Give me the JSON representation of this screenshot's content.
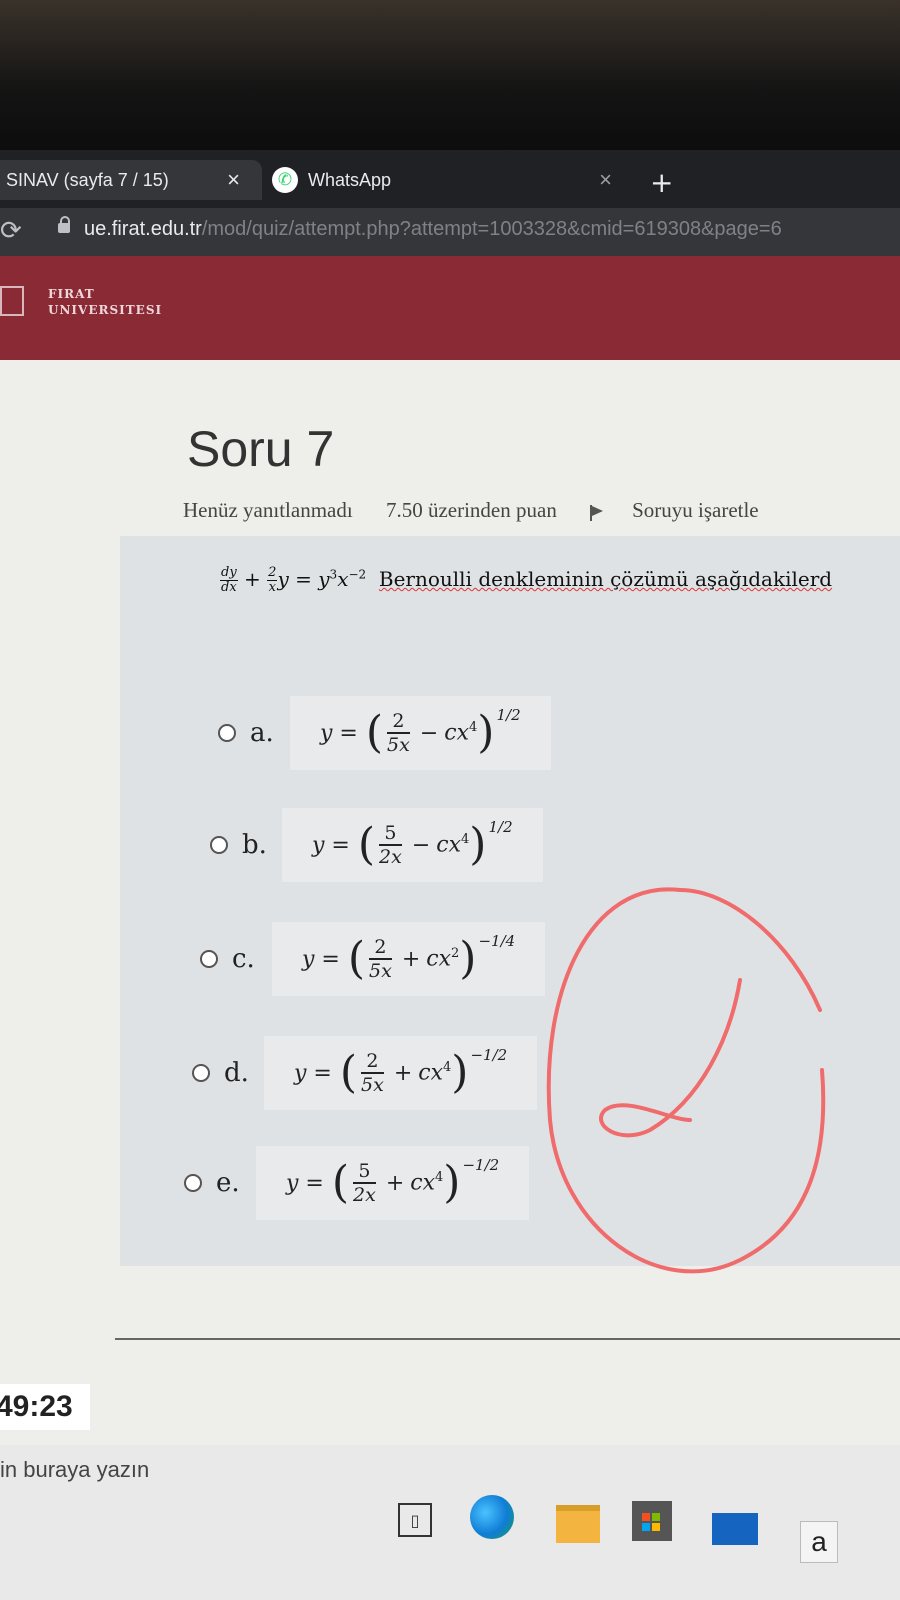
{
  "browser": {
    "tabs": [
      {
        "title": "SINAV (sayfa 7 / 15)",
        "close": "×"
      },
      {
        "title": "WhatsApp",
        "close": "×"
      }
    ],
    "new_tab": "+",
    "url_host": "ue.firat.edu.tr",
    "url_path": "/mod/quiz/attempt.php?attempt=1003328&cmid=619308&page=6"
  },
  "site": {
    "logo_line1": "FIRAT",
    "logo_line2": "UNIVERSITESI"
  },
  "question": {
    "title": "Soru 7",
    "status": "Henüz yanıtlanmadı",
    "points": "7.50 üzerinden puan",
    "flag_label": "Soruyu işaretle",
    "text_rest": "Bernoulli denkleminin çözümü aşağıdakilerd"
  },
  "options": [
    {
      "letter": "a.",
      "num": "2",
      "den": "5x",
      "sign": "−",
      "term": "cx",
      "term_exp": "4",
      "exp": "1/2"
    },
    {
      "letter": "b.",
      "num": "5",
      "den": "2x",
      "sign": "−",
      "term": "cx",
      "term_exp": "4",
      "exp": "1/2"
    },
    {
      "letter": "c.",
      "num": "2",
      "den": "5x",
      "sign": "+",
      "term": "cx",
      "term_exp": "2",
      "exp": "−1/4"
    },
    {
      "letter": "d.",
      "num": "2",
      "den": "5x",
      "sign": "+",
      "term": "cx",
      "term_exp": "4",
      "exp": "−1/2"
    },
    {
      "letter": "e.",
      "num": "5",
      "den": "2x",
      "sign": "+",
      "term": "cx",
      "term_exp": "4",
      "exp": "−1/2"
    }
  ],
  "timer": "49:23",
  "taskbar": {
    "search_placeholder": "in buraya yazın",
    "amazon_label": "a"
  },
  "colors": {
    "header": "#8a2a35",
    "annotation": "#f06b6b",
    "page": "#eeeeea"
  }
}
